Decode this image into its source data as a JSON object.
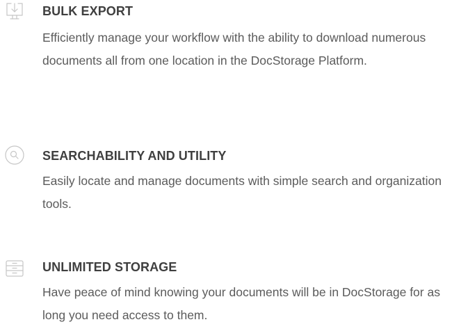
{
  "colors": {
    "title": "#3f3f3f",
    "text": "#5b5b5b",
    "icon_stroke": "#c6c6c6",
    "background": "#ffffff"
  },
  "features": [
    {
      "icon": "download-icon",
      "title": "BULK EXPORT",
      "description": "Efficiently manage your workflow with the ability to download numerous documents all from one location in the DocStorage Platform."
    },
    {
      "icon": "search-icon",
      "title": "SEARCHABILITY AND UTILITY",
      "description": "Easily locate and manage documents with simple search and organization tools."
    },
    {
      "icon": "storage-box-icon",
      "title": "UNLIMITED STORAGE",
      "description": "Have peace of mind knowing your documents will be in DocStorage for as long you need access to them."
    }
  ]
}
